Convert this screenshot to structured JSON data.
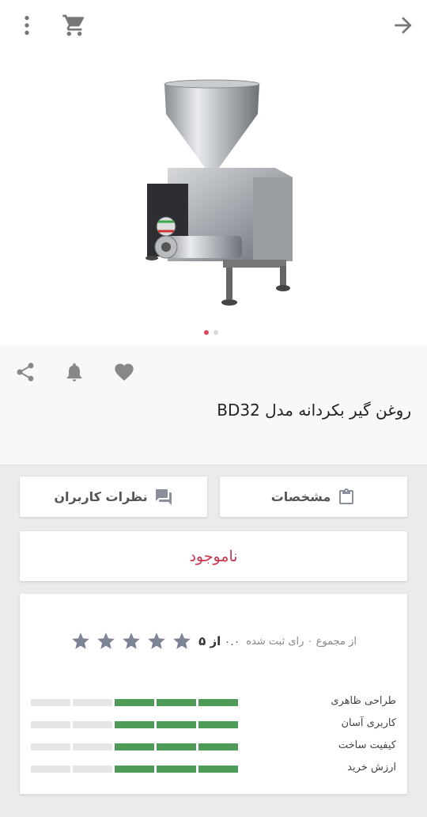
{
  "toolbar": {
    "more_icon": "more-vert-icon",
    "cart_icon": "shopping-cart-icon",
    "back_icon": "arrow-forward-icon"
  },
  "gallery": {
    "image_label": "BD32 oil press machine photo",
    "page_count": 2,
    "active_page": 1,
    "accent": "#e0485a"
  },
  "product": {
    "title": "روغن گیر بکردانه مدل BD32",
    "actions": [
      "share-icon",
      "notification-bell-icon",
      "favorite-heart-icon"
    ]
  },
  "buttons": {
    "specs_label": "مشخصات",
    "reviews_label": "نظرات کاربران"
  },
  "stock": {
    "status": "ناموجود",
    "color": "#c8354a"
  },
  "ratings": {
    "summary_prefix": "از مجموع ۰ رای ثبت شده",
    "score": "۰.۰",
    "score_suffix": "از ۵",
    "stars_filled": 0,
    "stars_total": 5,
    "criteria": [
      {
        "label": "طراحی ظاهری",
        "level": 3,
        "max": 5
      },
      {
        "label": "کاربری آسان",
        "level": 3,
        "max": 5
      },
      {
        "label": "کیفیت ساخت",
        "level": 3,
        "max": 5
      },
      {
        "label": "ارزش خرید",
        "level": 3,
        "max": 5
      }
    ],
    "bar_color": "#4e9b58"
  }
}
